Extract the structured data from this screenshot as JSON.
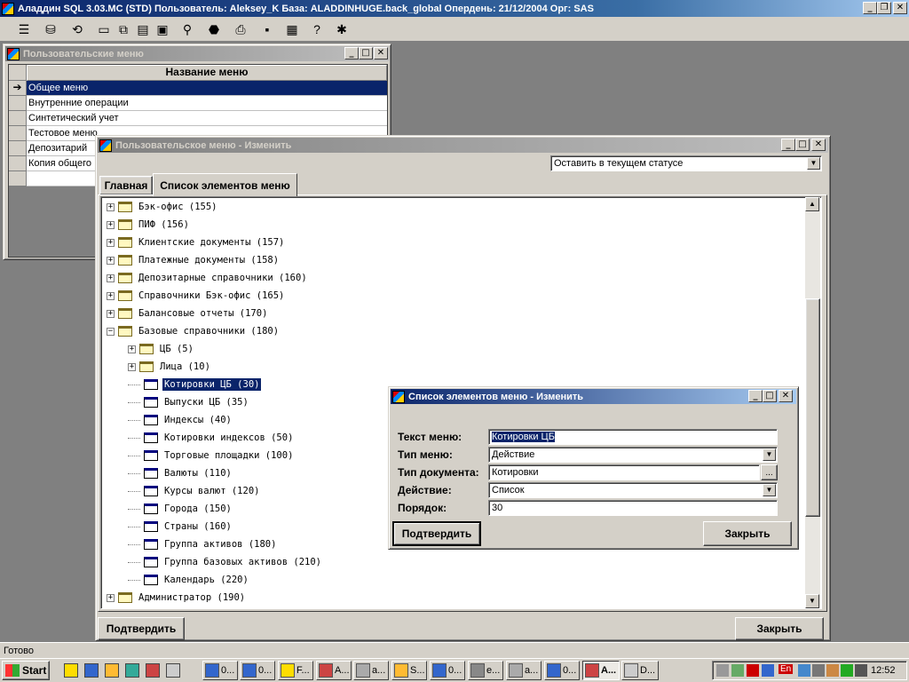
{
  "app": {
    "title": "Аладдин SQL 3.03.MC (STD) Пользователь: Aleksey_K База: ALADDINHUGE.back_global Опердень: 21/12/2004 Орг: SAS",
    "status": "Готово"
  },
  "toolbar": {
    "icons": [
      "list-icon",
      "database-icon",
      "refresh-icon",
      "window-icon",
      "cascade-icon",
      "tile-icon",
      "restore-icon",
      "binoculars-icon",
      "stop-icon",
      "print-icon",
      "save-icon",
      "calculator-icon",
      "help-icon",
      "tool-icon"
    ]
  },
  "user_menus": {
    "title": "Пользовательские меню",
    "header": "Название меню",
    "rows": [
      "Общее меню",
      "Внутренние операции",
      "Синтетический учет",
      "Тестовое меню",
      "Депозитарий",
      "Копия общего"
    ]
  },
  "edit_menu": {
    "title": "Пользовательское меню - Изменить",
    "status_select": "Оставить в текущем статусе",
    "tabs": [
      "Главная",
      "Список элементов меню"
    ],
    "confirm": "Подтвердить",
    "close": "Закрыть",
    "tree": [
      {
        "label": "Бэк-офис (155)",
        "type": "folder",
        "level": 0,
        "expanded": false
      },
      {
        "label": "ПИФ (156)",
        "type": "folder",
        "level": 0,
        "expanded": false
      },
      {
        "label": "Клиентские документы (157)",
        "type": "folder",
        "level": 0,
        "expanded": false
      },
      {
        "label": "Платежные документы (158)",
        "type": "folder",
        "level": 0,
        "expanded": false
      },
      {
        "label": "Депозитарные справочники (160)",
        "type": "folder",
        "level": 0,
        "expanded": false
      },
      {
        "label": "Справочники Бэк-офис (165)",
        "type": "folder",
        "level": 0,
        "expanded": false
      },
      {
        "label": "Балансовые отчеты (170)",
        "type": "folder",
        "level": 0,
        "expanded": false
      },
      {
        "label": "Базовые справочники (180)",
        "type": "folder",
        "level": 0,
        "expanded": true
      },
      {
        "label": "ЦБ (5)",
        "type": "folder",
        "level": 1,
        "expanded": false
      },
      {
        "label": "Лица (10)",
        "type": "folder",
        "level": 1,
        "expanded": false
      },
      {
        "label": "Котировки ЦБ (30)",
        "type": "doc",
        "level": 1,
        "selected": true
      },
      {
        "label": "Выпуски ЦБ (35)",
        "type": "doc",
        "level": 1
      },
      {
        "label": "Индексы (40)",
        "type": "doc",
        "level": 1
      },
      {
        "label": "Котировки индексов (50)",
        "type": "doc",
        "level": 1
      },
      {
        "label": "Торговые площадки (100)",
        "type": "doc",
        "level": 1
      },
      {
        "label": "Валюты (110)",
        "type": "doc",
        "level": 1
      },
      {
        "label": "Курсы валют (120)",
        "type": "doc",
        "level": 1
      },
      {
        "label": "Города (150)",
        "type": "doc",
        "level": 1
      },
      {
        "label": "Страны (160)",
        "type": "doc",
        "level": 1
      },
      {
        "label": "Группа активов (180)",
        "type": "doc",
        "level": 1
      },
      {
        "label": "Группа базовых активов (210)",
        "type": "doc",
        "level": 1
      },
      {
        "label": "Календарь (220)",
        "type": "doc",
        "level": 1
      },
      {
        "label": "Администратор (190)",
        "type": "folder",
        "level": 0,
        "expanded": false
      }
    ]
  },
  "item_dialog": {
    "title": "Список элементов меню - Изменить",
    "text_label": "Текст меню:",
    "text_value": "Котировки ЦБ",
    "type_label": "Тип меню:",
    "type_value": "Действие",
    "doctype_label": "Тип документа:",
    "doctype_value": "Котировки",
    "action_label": "Действие:",
    "action_value": "Список",
    "order_label": "Порядок:",
    "order_value": "30",
    "confirm": "Подтвердить",
    "close": "Закрыть",
    "browse": "..."
  },
  "taskbar": {
    "start": "Start",
    "tasks": [
      "0...",
      "0...",
      "F...",
      "A...",
      "a...",
      "S...",
      "0...",
      "e...",
      "a...",
      "0...",
      "A...",
      "D..."
    ],
    "lang": "En",
    "clock": "12:52"
  }
}
